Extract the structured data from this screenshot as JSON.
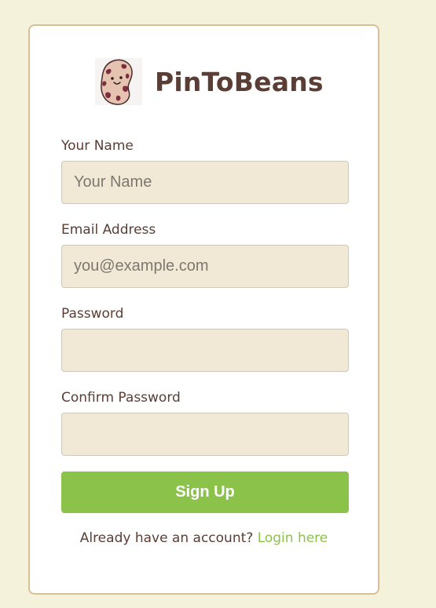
{
  "brand": {
    "name": "PinToBeans",
    "logo_icon": "bean-mascot-icon"
  },
  "form": {
    "fields": [
      {
        "label": "Your Name",
        "placeholder": "Your Name",
        "value": "",
        "type": "text"
      },
      {
        "label": "Email Address",
        "placeholder": "you@example.com",
        "value": "",
        "type": "email"
      },
      {
        "label": "Password",
        "placeholder": "",
        "value": "",
        "type": "password"
      },
      {
        "label": "Confirm Password",
        "placeholder": "",
        "value": "",
        "type": "password"
      }
    ],
    "submit_label": "Sign Up"
  },
  "footer": {
    "prompt": "Already have an account?",
    "link_label": "Login here"
  },
  "colors": {
    "page_background": "#f5f2dc",
    "card_border": "#d8bf97",
    "input_background": "#f1e8d5",
    "text": "#5a3e35",
    "accent_green": "#8bc34a"
  }
}
